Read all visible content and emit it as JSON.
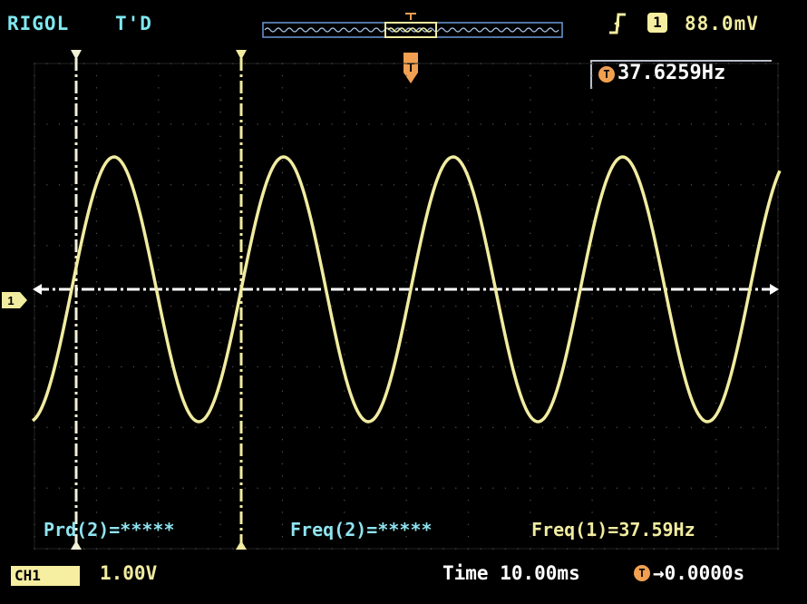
{
  "header": {
    "brand": "RIGOL",
    "run_status": "T'D",
    "trigger_level": "88.0mV",
    "trigger_channel": "1",
    "trigger_slope_icon": "rising-edge-icon",
    "trigger_marker": "T"
  },
  "frequency_counter": {
    "icon": "T",
    "value": "37.6259Hz"
  },
  "measurements": {
    "period_ch2": "Prd(2)=*****",
    "freq_ch2": "Freq(2)=*****",
    "freq_ch1": "Freq(1)=37.59Hz"
  },
  "footer": {
    "channel_label": "CH1",
    "volts_per_div": "1.00V",
    "timebase": "Time 10.00ms",
    "trigger_icon": "T",
    "trigger_offset": "→0.0000s"
  },
  "ch1_marker": "1",
  "colors": {
    "trace": "#f1eca0",
    "text_cyan": "#7fe8f0",
    "trigger_orange": "#f0a050",
    "background": "#000000"
  }
}
